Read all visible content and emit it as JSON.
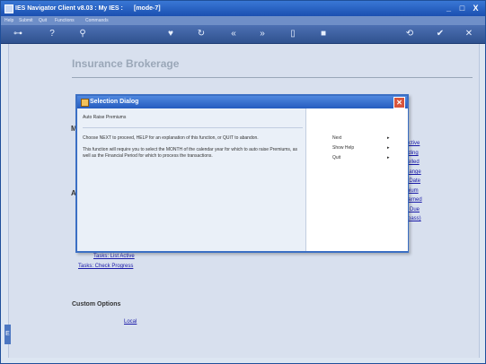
{
  "window": {
    "title": "IES Navigator Client v8.03 : My IES :",
    "mode": "[mode-7]",
    "controls": [
      "_",
      "□",
      "X"
    ]
  },
  "menu": [
    "Help",
    "Submit",
    "Quit",
    "Functions",
    "Commands"
  ],
  "page": {
    "heading": "Insurance Brokerage",
    "right_links": [
      "Active",
      "nding",
      "celled",
      "Range",
      "ll Date",
      "mium",
      "earned",
      "h Due",
      "ypass)"
    ],
    "partial_letters": [
      "M",
      "A"
    ],
    "tasks": [
      "Tasks: List Active",
      "Tasks: Check Progress"
    ],
    "custom_options_heading": "Custom Options",
    "local_link": "Local"
  },
  "dialog": {
    "title": "Selection Dialog",
    "heading": "Auto Raise Premiums",
    "instructions": "Choose NEXT to proceed, HELP for an explanation of this function, or QUIT to abandon.",
    "description": "This function will require you to select the MONTH of the calendar year for which to auto raise Premiums, as well as the Financial Period for which to process the transactions.",
    "options": [
      {
        "label": "Next",
        "arrow": "▸"
      },
      {
        "label": "Show Help",
        "arrow": "▸"
      },
      {
        "label": "Quit",
        "arrow": "▸"
      }
    ]
  }
}
